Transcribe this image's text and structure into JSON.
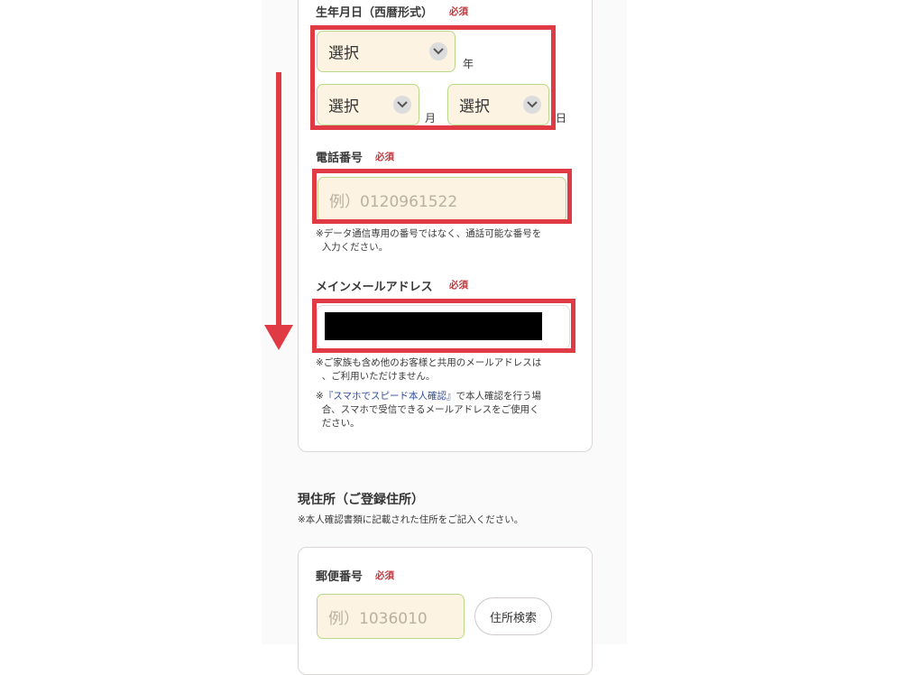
{
  "birthdate": {
    "label": "生年月日（西暦形式）",
    "required": "必須",
    "year_value": "選択",
    "year_unit": "年",
    "month_value": "選択",
    "month_unit": "月",
    "day_value": "選択",
    "day_unit": "日"
  },
  "phone": {
    "label": "電話番号",
    "required": "必須",
    "placeholder": "例）0120961522",
    "note_line1": "※データ通信専用の番号ではなく、通話可能な番号を",
    "note_line2": "入力ください。"
  },
  "email": {
    "label": "メインメールアドレス",
    "required": "必須",
    "note1_line1": "※ご家族も含め他のお客様と共用のメールアドレスは",
    "note1_line2": "、ご利用いただけません。",
    "note2_prefix": "※",
    "note2_link": "『スマホでスピード本人確認』",
    "note2_rest": "で本人確認を行う場",
    "note2_line2": "合、スマホで受信できるメールアドレスをご使用く",
    "note2_line3": "ださい。"
  },
  "address": {
    "title": "現住所（ご登録住所）",
    "note": "※本人確認書類に記載された住所をご記入ください。",
    "postal_label": "郵便番号",
    "required": "必須",
    "postal_placeholder": "例）1036010",
    "search_button": "住所検索"
  },
  "colors": {
    "highlight": "#e03a44",
    "required": "#c9353a",
    "field_bg": "#fdf3e2",
    "field_border": "#b9d98a",
    "link": "#2f4b9e"
  }
}
